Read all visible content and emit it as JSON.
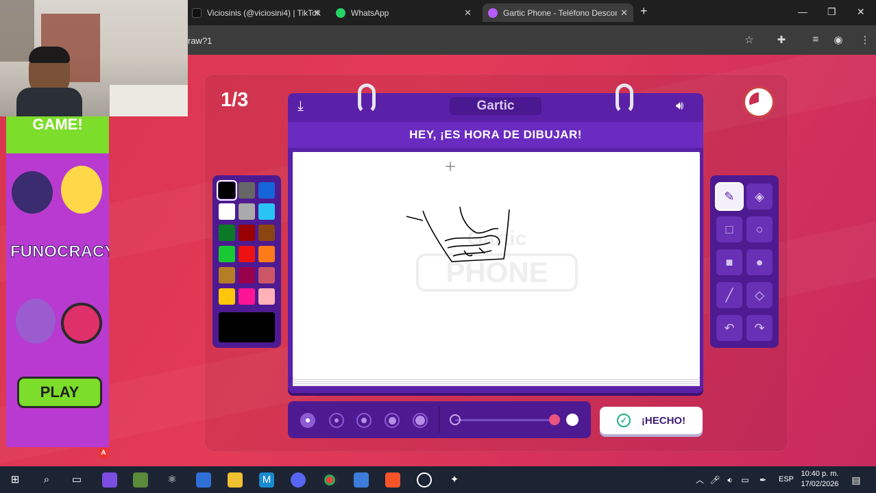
{
  "browser": {
    "tabs": [
      {
        "label": "Viciosinis (@viciosini4) | TikTok",
        "icon": "tiktok-icon"
      },
      {
        "label": "WhatsApp",
        "icon": "whatsapp-icon"
      },
      {
        "label": "Gartic Phone - Teléfono Descon",
        "icon": "phone-icon"
      }
    ],
    "new_tab": "+",
    "url": "raw?1"
  },
  "game": {
    "round": "1/3",
    "logo": "Gartic",
    "banner": "HEY, ¡ES HORA DE DIBUJAR!",
    "done_label": "¡HECHO!",
    "watermark_top": "Gartic",
    "watermark_bottom": "PHONE"
  },
  "palette": {
    "colors": [
      "#000000",
      "#666666",
      "#1565d8",
      "#ffffff",
      "#aaaaaa",
      "#29c4f4",
      "#0b7a26",
      "#990000",
      "#8a4511",
      "#19c934",
      "#ee1111",
      "#ff7a18",
      "#b57e26",
      "#99004c",
      "#cc5566",
      "#ffc60a",
      "#ff1493",
      "#ffb0b8"
    ],
    "selected_color": "#000000"
  },
  "tools": [
    "pencil-icon",
    "eraser-icon",
    "rect-outline-icon",
    "circle-outline-icon",
    "rect-fill-icon",
    "circle-fill-icon",
    "line-icon",
    "bucket-icon",
    "undo-icon",
    "redo-icon"
  ],
  "ad": {
    "headline": "GAME!",
    "brand": "FUNOCRACY",
    "cta": "PLAY",
    "badge": "A"
  },
  "taskbar": {
    "lang": "ESP",
    "time": "10:40 p. m.",
    "date": "17/02/2026"
  }
}
